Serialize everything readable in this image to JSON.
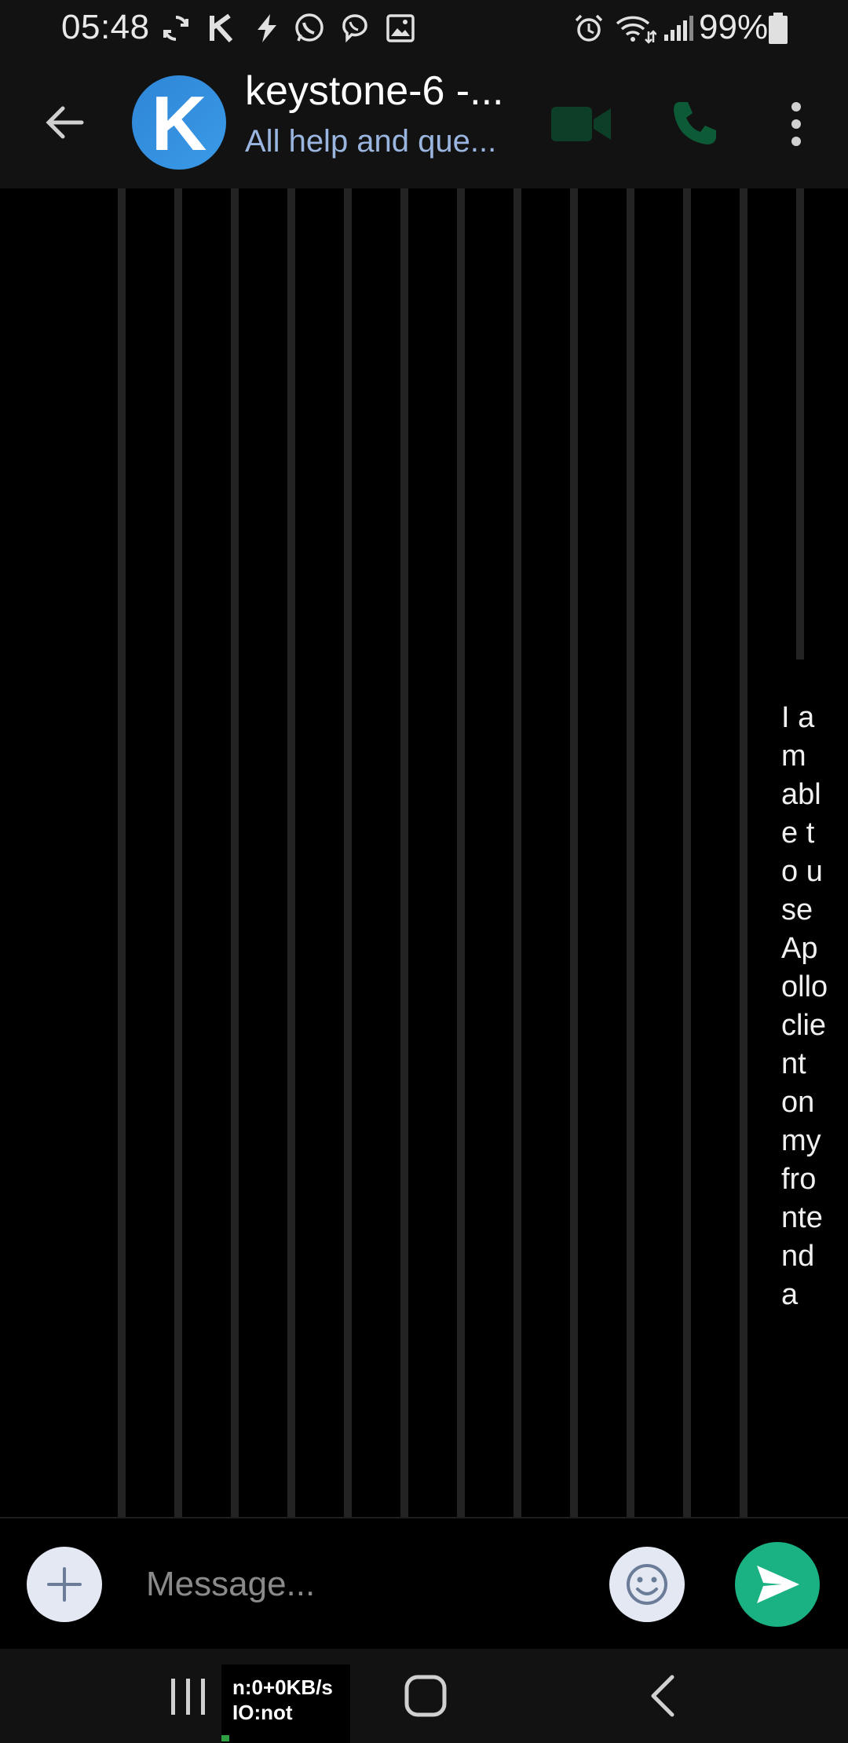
{
  "status_bar": {
    "time": "05:48",
    "battery_percent": "99%",
    "icons": [
      "sync-icon",
      "k-app-icon",
      "flash-icon",
      "whatsapp-icon",
      "viber-icon",
      "gallery-icon",
      "alarm-icon",
      "wifi-icon",
      "signal-icon",
      "battery-icon"
    ]
  },
  "header": {
    "avatar_letter": "K",
    "title": "keystone-6 -...",
    "subtitle": "All help and que...",
    "icons": [
      "back-arrow-icon",
      "video-call-icon",
      "phone-icon",
      "more-vert-icon"
    ],
    "colors": {
      "avatar": "#2f86d6",
      "subtitle": "#9ab6e0",
      "call_icons": "#0f5a3a"
    }
  },
  "chat": {
    "message_text": "I am able to use Apollo client on my frontend a"
  },
  "composer": {
    "placeholder": "Message...",
    "icons": [
      "plus-icon",
      "emoji-icon",
      "send-icon"
    ],
    "colors": {
      "send": "#1ab183",
      "round_buttons": "#e3e8f2"
    }
  },
  "nav": {
    "net_speed": "n:0+0KB/s",
    "io_status": "IO:not",
    "icons": [
      "recent-apps-icon",
      "home-icon",
      "back-icon"
    ]
  }
}
